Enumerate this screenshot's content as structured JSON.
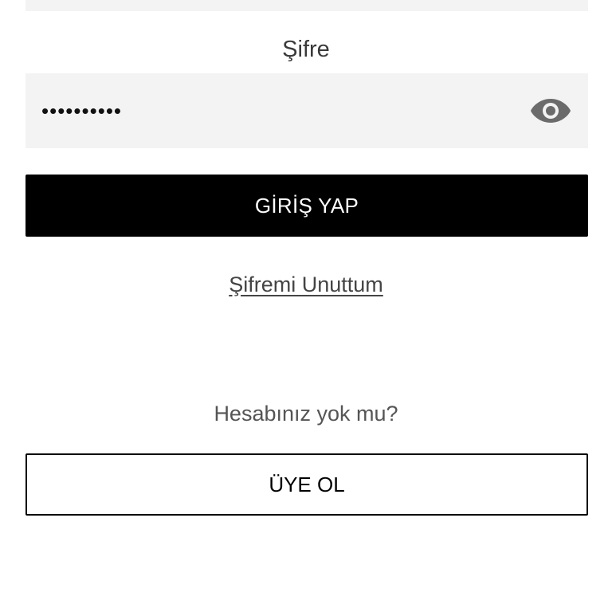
{
  "password": {
    "label": "Şifre",
    "value": "••••••••••",
    "toggle_icon": "eye-icon"
  },
  "login_button": {
    "label": "GİRİŞ YAP"
  },
  "forgot_password": {
    "label": "Şifremi Unuttum"
  },
  "signup": {
    "prompt": "Hesabınız yok mu?",
    "button_label": "ÜYE OL"
  },
  "colors": {
    "field_bg": "#f3f3f3",
    "primary_button_bg": "#000000",
    "primary_button_text": "#ffffff",
    "icon": "#6b6b6b"
  }
}
